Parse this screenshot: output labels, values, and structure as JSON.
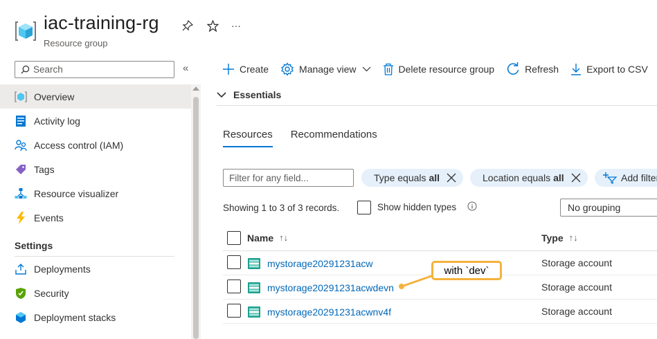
{
  "header": {
    "title": "iac-training-rg",
    "subtitle": "Resource group",
    "more_label": "···"
  },
  "sidebar": {
    "search_placeholder": "Search",
    "collapse_label": "«",
    "items": [
      {
        "label": "Overview",
        "icon": "overview-icon",
        "active": true
      },
      {
        "label": "Activity log",
        "icon": "activity-log-icon"
      },
      {
        "label": "Access control (IAM)",
        "icon": "iam-icon"
      },
      {
        "label": "Tags",
        "icon": "tag-icon"
      },
      {
        "label": "Resource visualizer",
        "icon": "visualizer-icon"
      },
      {
        "label": "Events",
        "icon": "lightning-icon"
      }
    ],
    "section_title": "Settings",
    "settings_items": [
      {
        "label": "Deployments",
        "icon": "deploy-icon"
      },
      {
        "label": "Security",
        "icon": "shield-icon"
      },
      {
        "label": "Deployment stacks",
        "icon": "stack-icon"
      }
    ]
  },
  "toolbar": {
    "create": "Create",
    "manage_view": "Manage view",
    "delete": "Delete resource group",
    "refresh": "Refresh",
    "export": "Export to CSV"
  },
  "essentials": {
    "label": "Essentials"
  },
  "tabs": [
    {
      "label": "Resources",
      "active": true
    },
    {
      "label": "Recommendations"
    }
  ],
  "filters": {
    "placeholder": "Filter for any field...",
    "type_prefix": "Type equals",
    "type_value": "all",
    "location_prefix": "Location equals",
    "location_value": "all",
    "add_filter": "Add filter"
  },
  "records": {
    "text": "Showing 1 to 3 of 3 records.",
    "show_hidden": "Show hidden types",
    "grouping": "No grouping"
  },
  "table": {
    "col_name": "Name",
    "col_type": "Type",
    "sort_glyph": "↑↓",
    "rows": [
      {
        "name": "mystorage20291231acw",
        "type": "Storage account"
      },
      {
        "name": "mystorage20291231acwdevn",
        "type": "Storage account"
      },
      {
        "name": "mystorage20291231acwnv4f",
        "type": "Storage account"
      }
    ]
  },
  "callout": {
    "text": "with `dev`"
  },
  "colors": {
    "accent": "#0078d4",
    "link": "#0067b8",
    "callout_border": "#f4b23c",
    "pill_bg": "#e5f0fb"
  }
}
